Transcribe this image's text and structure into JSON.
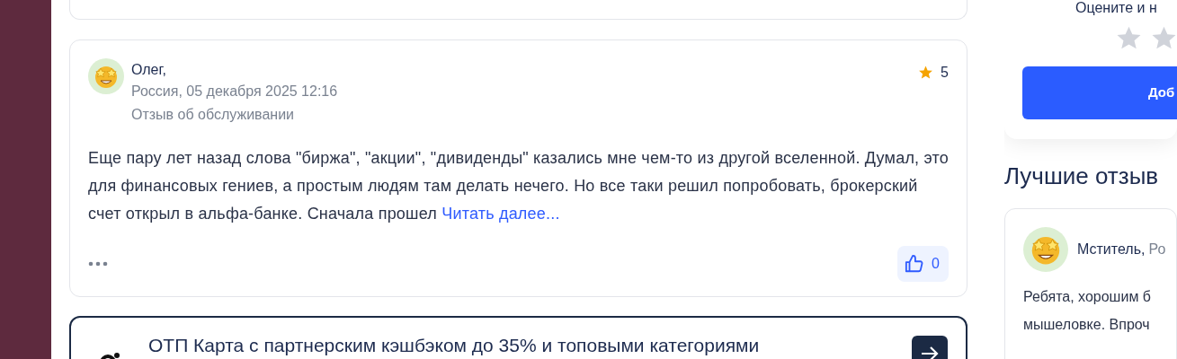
{
  "review": {
    "author": "Олег,",
    "meta": "Россия, 05 декабря 2025 12:16",
    "category": "Отзыв об обслуживании",
    "rating": "5",
    "text": "Еще пару лет назад слова \"биржа\", \"акции\", \"дивиденды\" казались мне чем-то из другой вселенной. Думал, это для финансовых гениев, а простым людям там делать нечего. Но все таки решил попробовать, брокерский счет открыл в альфа-банке. Сначала прошел",
    "read_more": "Читать далее...",
    "likes": "0"
  },
  "banner": {
    "text": "ОТП Карта с партнерским кэшбэком до 35% и топовыми категориями"
  },
  "sidebar": {
    "rate_prompt": "Оцените и н",
    "add_button": "Доб",
    "best_title": "Лучшие отзыв",
    "best_reviews": [
      {
        "author": "Мститель,",
        "location": "Ро",
        "lines": [
          "Ребята, хорошим б",
          "мышеловке. Впроч"
        ]
      }
    ]
  }
}
